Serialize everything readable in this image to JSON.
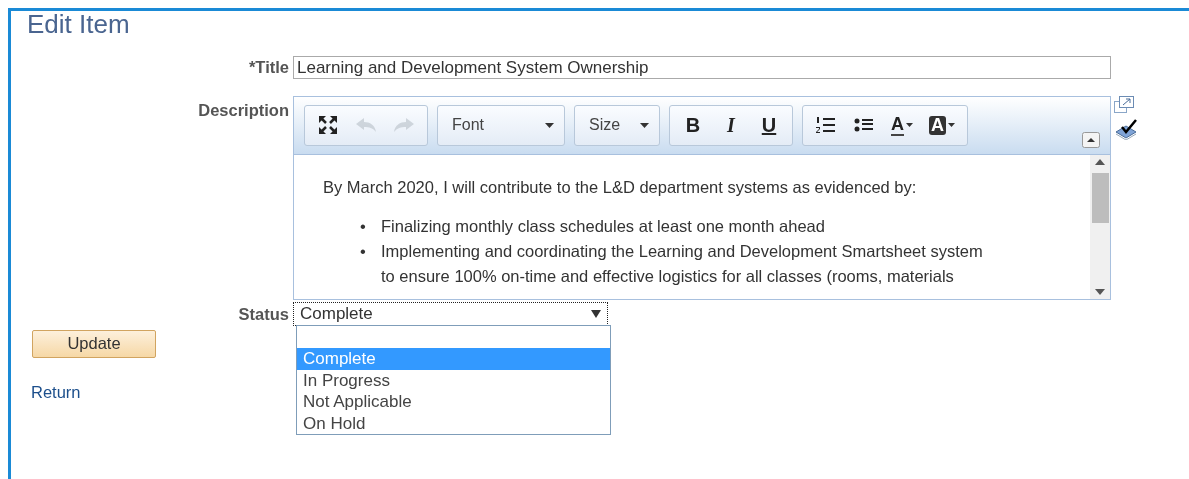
{
  "page": {
    "title": "Edit Item"
  },
  "title_field": {
    "label": "*Title",
    "value": "Learning and Development System Ownership"
  },
  "description": {
    "label": "Description",
    "toolbar": [
      [
        {
          "kind": "maximize",
          "disabled": false
        },
        {
          "kind": "undo",
          "disabled": true
        },
        {
          "kind": "redo",
          "disabled": true
        }
      ],
      [
        {
          "kind": "combo",
          "label": "Font",
          "disabled": false
        }
      ],
      [
        {
          "kind": "combo",
          "label": "Size",
          "disabled": false
        }
      ],
      [
        {
          "kind": "bold",
          "label": "B",
          "disabled": false
        },
        {
          "kind": "italic",
          "label": "I",
          "disabled": false
        },
        {
          "kind": "underline",
          "label": "U",
          "disabled": false
        }
      ],
      [
        {
          "kind": "ordered-list",
          "disabled": false
        },
        {
          "kind": "bullet-list",
          "disabled": false
        },
        {
          "kind": "text-color",
          "label": "A",
          "disabled": false
        },
        {
          "kind": "bg-color",
          "label": "A",
          "disabled": false
        }
      ]
    ],
    "intro": "By March 2020, I will contribute to the L&D department systems as evidenced by:",
    "bullets": [
      {
        "marker": "•",
        "text": "Finalizing monthly class schedules at least one month ahead"
      },
      {
        "marker": "•",
        "text": "Implementing and coordinating the Learning and Development Smartsheet system to ensure 100% on-time and effective logistics for all classes (rooms, materials"
      }
    ]
  },
  "status": {
    "label": "Status",
    "value": "Complete",
    "expanded": true,
    "options": [
      {
        "label": "Complete",
        "selected": true
      },
      {
        "label": "In Progress",
        "selected": false
      },
      {
        "label": "Not Applicable",
        "selected": false
      },
      {
        "label": "On Hold",
        "selected": false
      }
    ]
  },
  "update_button": "Update",
  "return_link": "Return"
}
